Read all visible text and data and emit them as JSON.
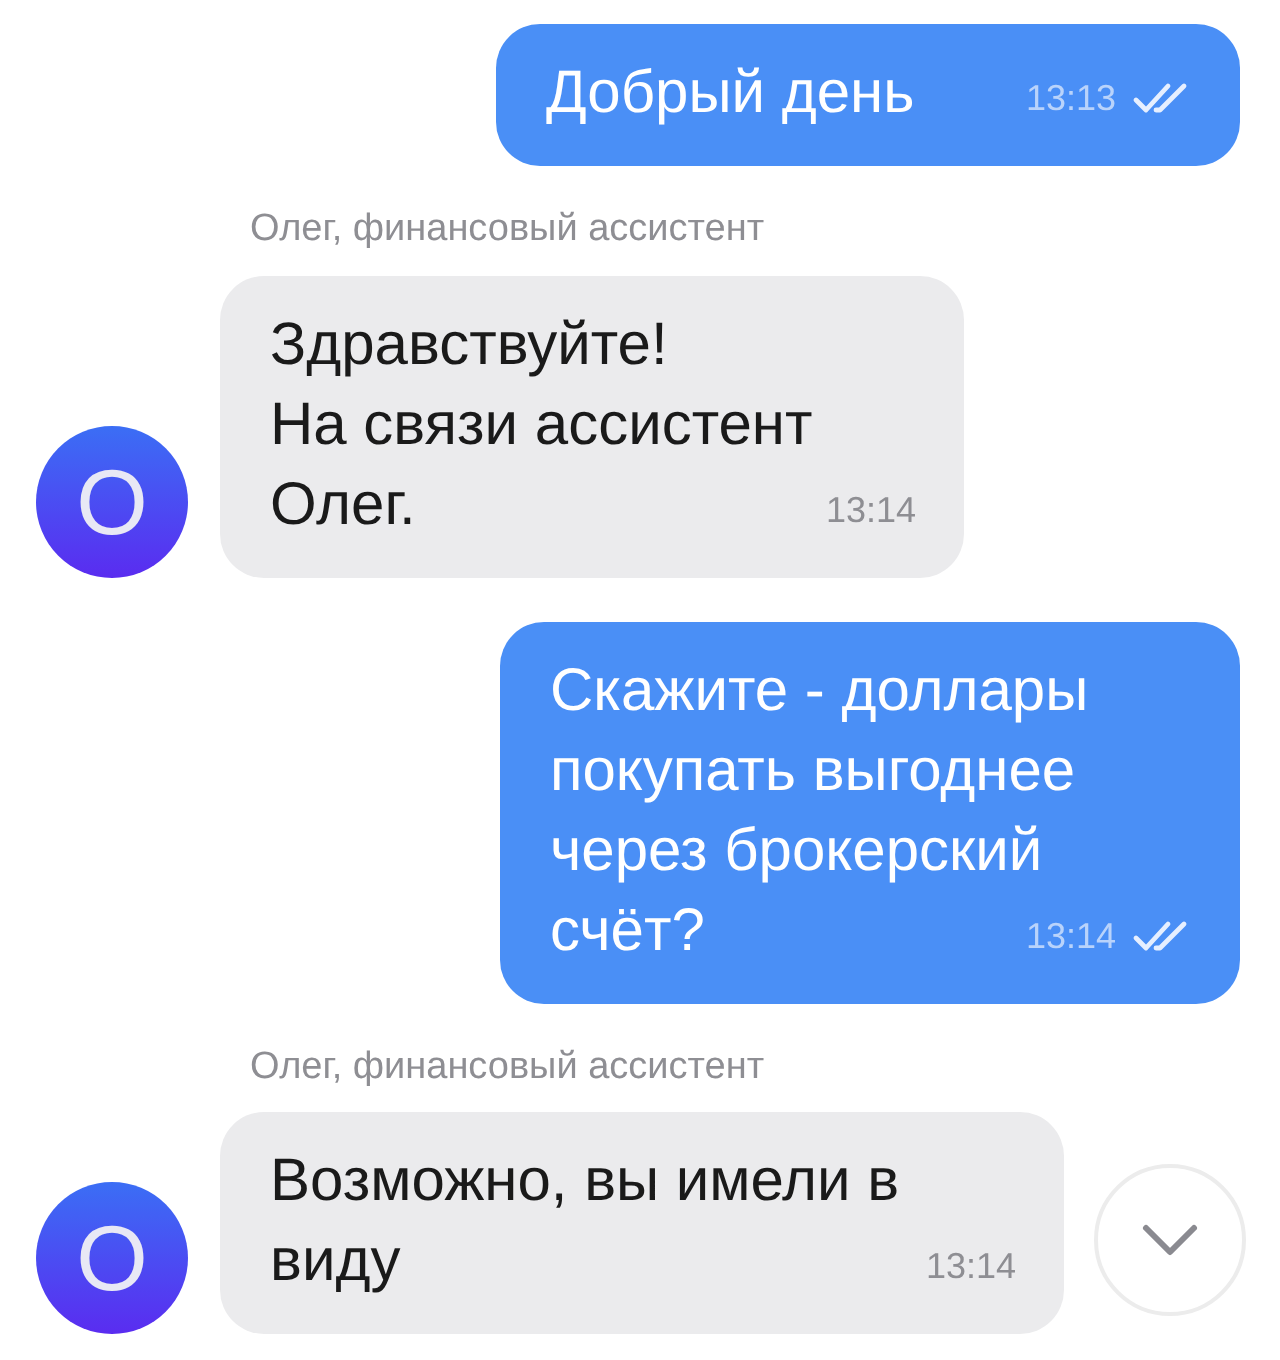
{
  "messages": [
    {
      "kind": "out",
      "lines": [
        "Добрый день"
      ],
      "time": "13:13",
      "read": true
    },
    {
      "kind": "in",
      "sender": "Олег, финансовый ассистент",
      "avatar": "О",
      "lines": [
        "Здравствуйте!",
        "На связи ассистент",
        "Олег."
      ],
      "time": "13:14"
    },
    {
      "kind": "out",
      "lines": [
        "Скажите - доллары",
        "покупать выгоднее",
        "через брокерский",
        "счёт?"
      ],
      "time": "13:14",
      "read": true
    },
    {
      "kind": "in",
      "sender": "Олег, финансовый ассистент",
      "avatar": "О",
      "lines": [
        "Возможно, вы имели в",
        "виду"
      ],
      "time": "13:14"
    }
  ]
}
